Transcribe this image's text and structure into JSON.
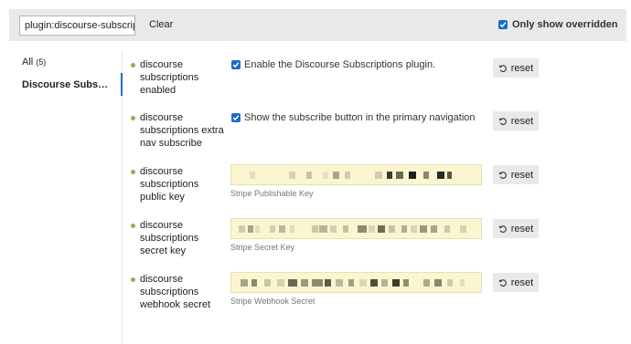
{
  "filter": {
    "value": "plugin:discourse-subscripti"
  },
  "clear_label": "Clear",
  "only_overridden_label": "Only show overridden",
  "nav": {
    "all_label": "All",
    "all_count": "(5)",
    "plugin_label": "Discourse Subscriptions"
  },
  "reset_label": "reset",
  "settings": [
    {
      "name": "discourse subscriptions enabled",
      "type": "checkbox",
      "description": "Enable the Discourse Subscriptions plugin."
    },
    {
      "name": "discourse subscriptions extra nav subscribe",
      "type": "checkbox",
      "description": "Show the subscribe button in the primary navigation"
    },
    {
      "name": "discourse subscriptions public key",
      "type": "text",
      "description": "Stripe Publishable Key"
    },
    {
      "name": "discourse subscriptions secret key",
      "type": "text",
      "description": "Stripe Secret Key"
    },
    {
      "name": "discourse subscriptions webhook secret",
      "type": "text",
      "description": "Stripe Webhook Secret"
    }
  ],
  "colors": {
    "accent": "#1a6ccf",
    "override_dot": "#b1a347",
    "field_bg": "#fbf6cf"
  }
}
